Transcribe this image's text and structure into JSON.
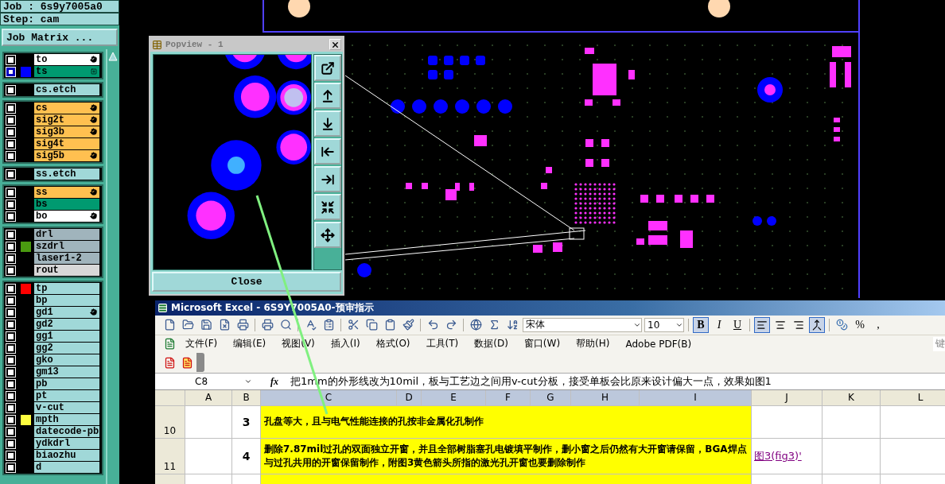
{
  "job": {
    "job_label": "Job : 6s9y7005a0",
    "step_label": "Step: cam",
    "matrix_button": "Job Matrix ..."
  },
  "layer_groups": [
    {
      "layers": [
        {
          "name": "to",
          "kind": "overlay",
          "hand": true,
          "grid": false,
          "selected": false
        },
        {
          "name": "ts",
          "kind": "mask",
          "color": "#0000ff",
          "hand": false,
          "grid": true,
          "selected": true
        }
      ]
    },
    {
      "layers": [
        {
          "name": "cs.etch",
          "kind": "etch",
          "hand": false,
          "grid": false,
          "selected": false
        }
      ]
    },
    {
      "layers": [
        {
          "name": "cs",
          "kind": "signal",
          "hand": true,
          "grid": false,
          "selected": false
        },
        {
          "name": "sig2t",
          "kind": "signal",
          "hand": true,
          "grid": false,
          "selected": false
        },
        {
          "name": "sig3b",
          "kind": "signal",
          "hand": true,
          "grid": false,
          "selected": false
        },
        {
          "name": "sig4t",
          "kind": "signal",
          "hand": false,
          "grid": false,
          "selected": false
        },
        {
          "name": "sig5b",
          "kind": "signal",
          "hand": true,
          "grid": false,
          "selected": false
        }
      ]
    },
    {
      "layers": [
        {
          "name": "ss.etch",
          "kind": "etch",
          "hand": false,
          "grid": false,
          "selected": false
        }
      ]
    },
    {
      "layers": [
        {
          "name": "ss",
          "kind": "signal",
          "hand": true,
          "grid": false,
          "selected": false
        },
        {
          "name": "bs",
          "kind": "mask",
          "hand": false,
          "grid": false,
          "selected": false
        },
        {
          "name": "bo",
          "kind": "overlay",
          "hand": true,
          "grid": false,
          "selected": false
        }
      ]
    },
    {
      "layers": [
        {
          "name": "drl",
          "kind": "drill",
          "hand": false,
          "grid": false,
          "selected": false
        },
        {
          "name": "szdrl",
          "kind": "drill",
          "color": "#4a9a10",
          "hand": false,
          "grid": false,
          "selected": false
        },
        {
          "name": "laser1-2",
          "kind": "drill",
          "hand": false,
          "grid": false,
          "selected": false
        },
        {
          "name": "rout",
          "kind": "rout",
          "hand": false,
          "grid": false,
          "selected": false
        }
      ]
    },
    {
      "layers": [
        {
          "name": "tp",
          "kind": "doc",
          "color": "#ff0000",
          "hand": false,
          "grid": false,
          "selected": false
        },
        {
          "name": "bp",
          "kind": "doc",
          "hand": false,
          "grid": false,
          "selected": false
        },
        {
          "name": "gd1",
          "kind": "doc",
          "hand": true,
          "grid": false,
          "selected": false
        },
        {
          "name": "gd2",
          "kind": "doc",
          "hand": false,
          "grid": false,
          "selected": false
        },
        {
          "name": "gg1",
          "kind": "doc",
          "hand": false,
          "grid": false,
          "selected": false
        },
        {
          "name": "gg2",
          "kind": "doc",
          "hand": false,
          "grid": false,
          "selected": false
        },
        {
          "name": "gko",
          "kind": "doc",
          "hand": false,
          "grid": false,
          "selected": false
        },
        {
          "name": "gm13",
          "kind": "doc",
          "hand": false,
          "grid": false,
          "selected": false
        },
        {
          "name": "pb",
          "kind": "doc",
          "hand": false,
          "grid": false,
          "selected": false
        },
        {
          "name": "pt",
          "kind": "doc",
          "hand": false,
          "grid": false,
          "selected": false
        },
        {
          "name": "v-cut",
          "kind": "doc",
          "hand": false,
          "grid": false,
          "selected": false
        },
        {
          "name": "mpth",
          "kind": "doc",
          "color": "#ffff40",
          "hand": false,
          "grid": false,
          "selected": false
        },
        {
          "name": "datecode-pb",
          "kind": "doc",
          "hand": false,
          "grid": false,
          "selected": false
        },
        {
          "name": "ydkdrl",
          "kind": "doc",
          "hand": false,
          "grid": false,
          "selected": false
        },
        {
          "name": "biaozhu",
          "kind": "doc",
          "hand": false,
          "grid": false,
          "selected": false
        },
        {
          "name": "d",
          "kind": "doc",
          "hand": false,
          "grid": false,
          "selected": false
        }
      ]
    }
  ],
  "popview": {
    "title": "Popview - 1",
    "close_button": "Close"
  },
  "excel": {
    "title": "Microsoft Excel - 6S9Y7005A0-预审指示",
    "font": "宋体",
    "font_size": "10",
    "format_buttons": [
      {
        "label": "B",
        "selected": true
      },
      {
        "label": "I",
        "selected": false
      },
      {
        "label": "U",
        "selected": false
      }
    ],
    "align_buttons": [
      {
        "kind": "left",
        "selected": true
      },
      {
        "kind": "center",
        "selected": false
      },
      {
        "kind": "right",
        "selected": false
      },
      {
        "kind": "merge",
        "selected": true
      }
    ],
    "number_buttons": [
      "%",
      ","
    ],
    "menu": [
      "文件(F)",
      "编辑(E)",
      "视图(V)",
      "插入(I)",
      "格式(O)",
      "工具(T)",
      "数据(D)",
      "窗口(W)",
      "帮助(H)",
      "Adobe PDF(B)"
    ],
    "help_box": "键",
    "name_box": "C8",
    "fx": "fx",
    "formula": "把1mm的外形线改为10mil，板与工艺边之间用v-cut分板，接受单板会比原来设计偏大一点，效果如图1",
    "columns": [
      {
        "label": "A",
        "selected": false
      },
      {
        "label": "B",
        "selected": false
      },
      {
        "label": "C",
        "selected": true
      },
      {
        "label": "D",
        "selected": true
      },
      {
        "label": "E",
        "selected": true
      },
      {
        "label": "F",
        "selected": true
      },
      {
        "label": "G",
        "selected": true
      },
      {
        "label": "H",
        "selected": true
      },
      {
        "label": "I",
        "selected": true
      },
      {
        "label": "J",
        "selected": false
      },
      {
        "label": "K",
        "selected": false
      },
      {
        "label": "L",
        "selected": false
      }
    ],
    "rows": [
      {
        "header": "10",
        "number": "3",
        "text": "孔盘等大，且与电气性能连接的孔按非金属化孔制作"
      },
      {
        "header": "11",
        "number": "4",
        "text": "删除7.87mil过孔的双面独立开窗，并且全部树脂塞孔电镀填平制作，删小窗之后仍然有大开窗请保留，BGA焊点与过孔共用的开窗保留制作，附图3黄色箭头所指的激光孔开窗也要删除制作",
        "link": "图3(fig3)'"
      }
    ]
  }
}
